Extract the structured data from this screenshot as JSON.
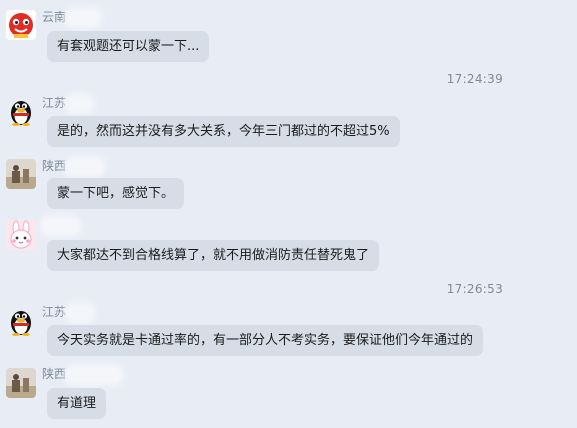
{
  "messages": [
    {
      "sender": "云南",
      "text": "有套观题还可以蒙一下..."
    },
    {
      "sender": "江苏",
      "text": "是的，然而这并没有多大关系，今年三门都过的不超过5%"
    },
    {
      "sender": "陕西",
      "text": "蒙一下吧，感觉下。"
    },
    {
      "sender": "",
      "text": "大家都达不到合格线算了，就不用做消防责任替死鬼了"
    },
    {
      "sender": "江苏",
      "text": "今天实务就是卡通过率的，有一部分人不考实务，要保证他们今年通过的"
    },
    {
      "sender": "陕西",
      "text": "有道理"
    }
  ],
  "timestamps": [
    "17:24:39",
    "17:26:53"
  ],
  "icons": [
    "red-mascot-avatar-icon",
    "penguin-avatar-icon",
    "photo-avatar-icon",
    "rabbit-avatar-icon"
  ],
  "colors": {
    "background": "#e8edf5",
    "bubble": "#d6dde7",
    "meta_text": "#7d8a99"
  }
}
